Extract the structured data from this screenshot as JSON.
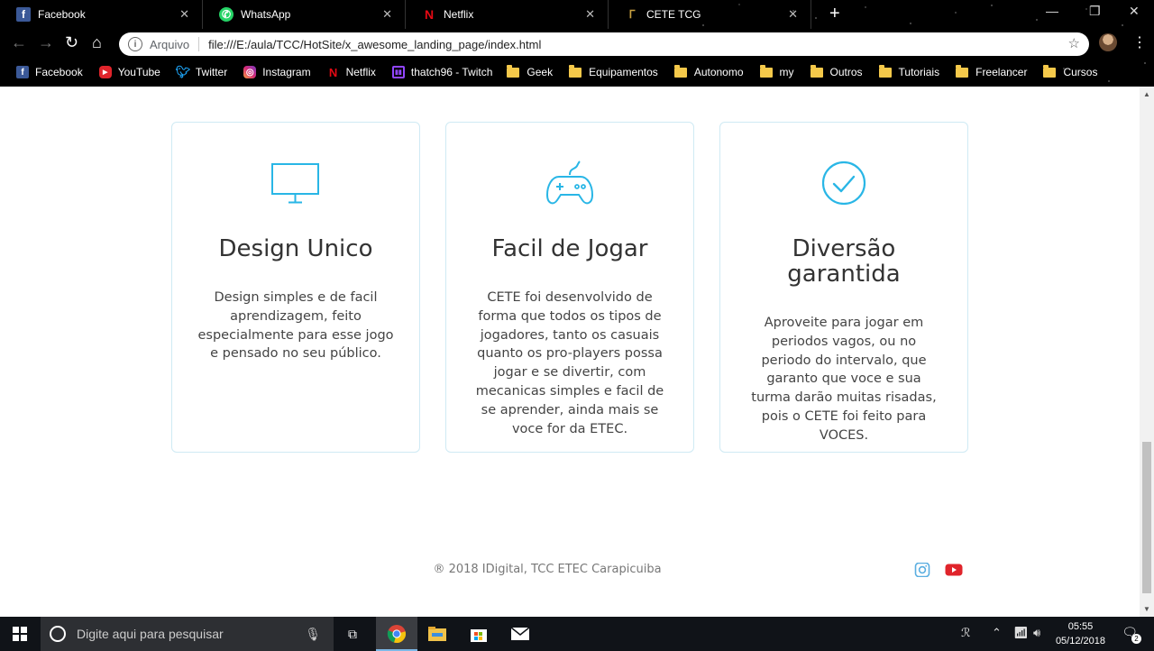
{
  "browser": {
    "tabs": [
      {
        "title": "Facebook",
        "icon": "facebook-icon",
        "color": "#3b5998"
      },
      {
        "title": "WhatsApp",
        "icon": "whatsapp-icon",
        "color": "#25d366"
      },
      {
        "title": "Netflix",
        "icon": "netflix-icon",
        "color": "#e50914"
      },
      {
        "title": "CETE TCG",
        "icon": "cete-icon",
        "color": "#c8a040"
      }
    ],
    "address": {
      "label": "Arquivo",
      "url": "file:///E:/aula/TCC/HotSite/x_awesome_landing_page/index.html"
    },
    "bookmarks": [
      {
        "label": "Facebook",
        "icon": "facebook-icon"
      },
      {
        "label": "YouTube",
        "icon": "youtube-icon"
      },
      {
        "label": "Twitter",
        "icon": "twitter-icon"
      },
      {
        "label": "Instagram",
        "icon": "instagram-icon"
      },
      {
        "label": "Netflix",
        "icon": "netflix-icon"
      },
      {
        "label": "thatch96 - Twitch",
        "icon": "twitch-icon"
      },
      {
        "label": "Geek",
        "icon": "folder-icon"
      },
      {
        "label": "Equipamentos",
        "icon": "folder-icon"
      },
      {
        "label": "Autonomo",
        "icon": "folder-icon"
      },
      {
        "label": "my",
        "icon": "folder-icon"
      },
      {
        "label": "Outros",
        "icon": "folder-icon"
      },
      {
        "label": "Tutoriais",
        "icon": "folder-icon"
      },
      {
        "label": "Freelancer",
        "icon": "folder-icon"
      },
      {
        "label": "Cursos",
        "icon": "folder-icon"
      }
    ]
  },
  "features": [
    {
      "icon": "monitor-icon",
      "title": "Design Unico",
      "text": "Design simples e de facil aprendizagem, feito especialmente para esse jogo e pensado no seu público."
    },
    {
      "icon": "gamepad-icon",
      "title": "Facil de Jogar",
      "text": "CETE foi desenvolvido de forma que todos os tipos de jogadores, tanto os casuais quanto os pro-players possa jogar e se divertir, com mecanicas simples e facil de se aprender, ainda mais se voce for da ETEC."
    },
    {
      "icon": "check-circle-icon",
      "title": "Diversão garantida",
      "text": "Aproveite para jogar em periodos vagos, ou no periodo do intervalo, que garanto que voce e sua turma darão muitas risadas, pois o CETE foi feito para VOCES."
    }
  ],
  "footer": {
    "copyright": "® 2018 IDigital, TCC ETEC Carapicuiba",
    "social": [
      "instagram-icon",
      "youtube-icon"
    ]
  },
  "taskbar": {
    "search_placeholder": "Digite aqui para pesquisar",
    "time": "05:55",
    "date": "05/12/2018",
    "notifications": "2"
  },
  "colors": {
    "accent": "#29b6e6",
    "card_border": "#cfeaf4",
    "youtube": "#e0242b",
    "instagram": "#5aaee0"
  }
}
